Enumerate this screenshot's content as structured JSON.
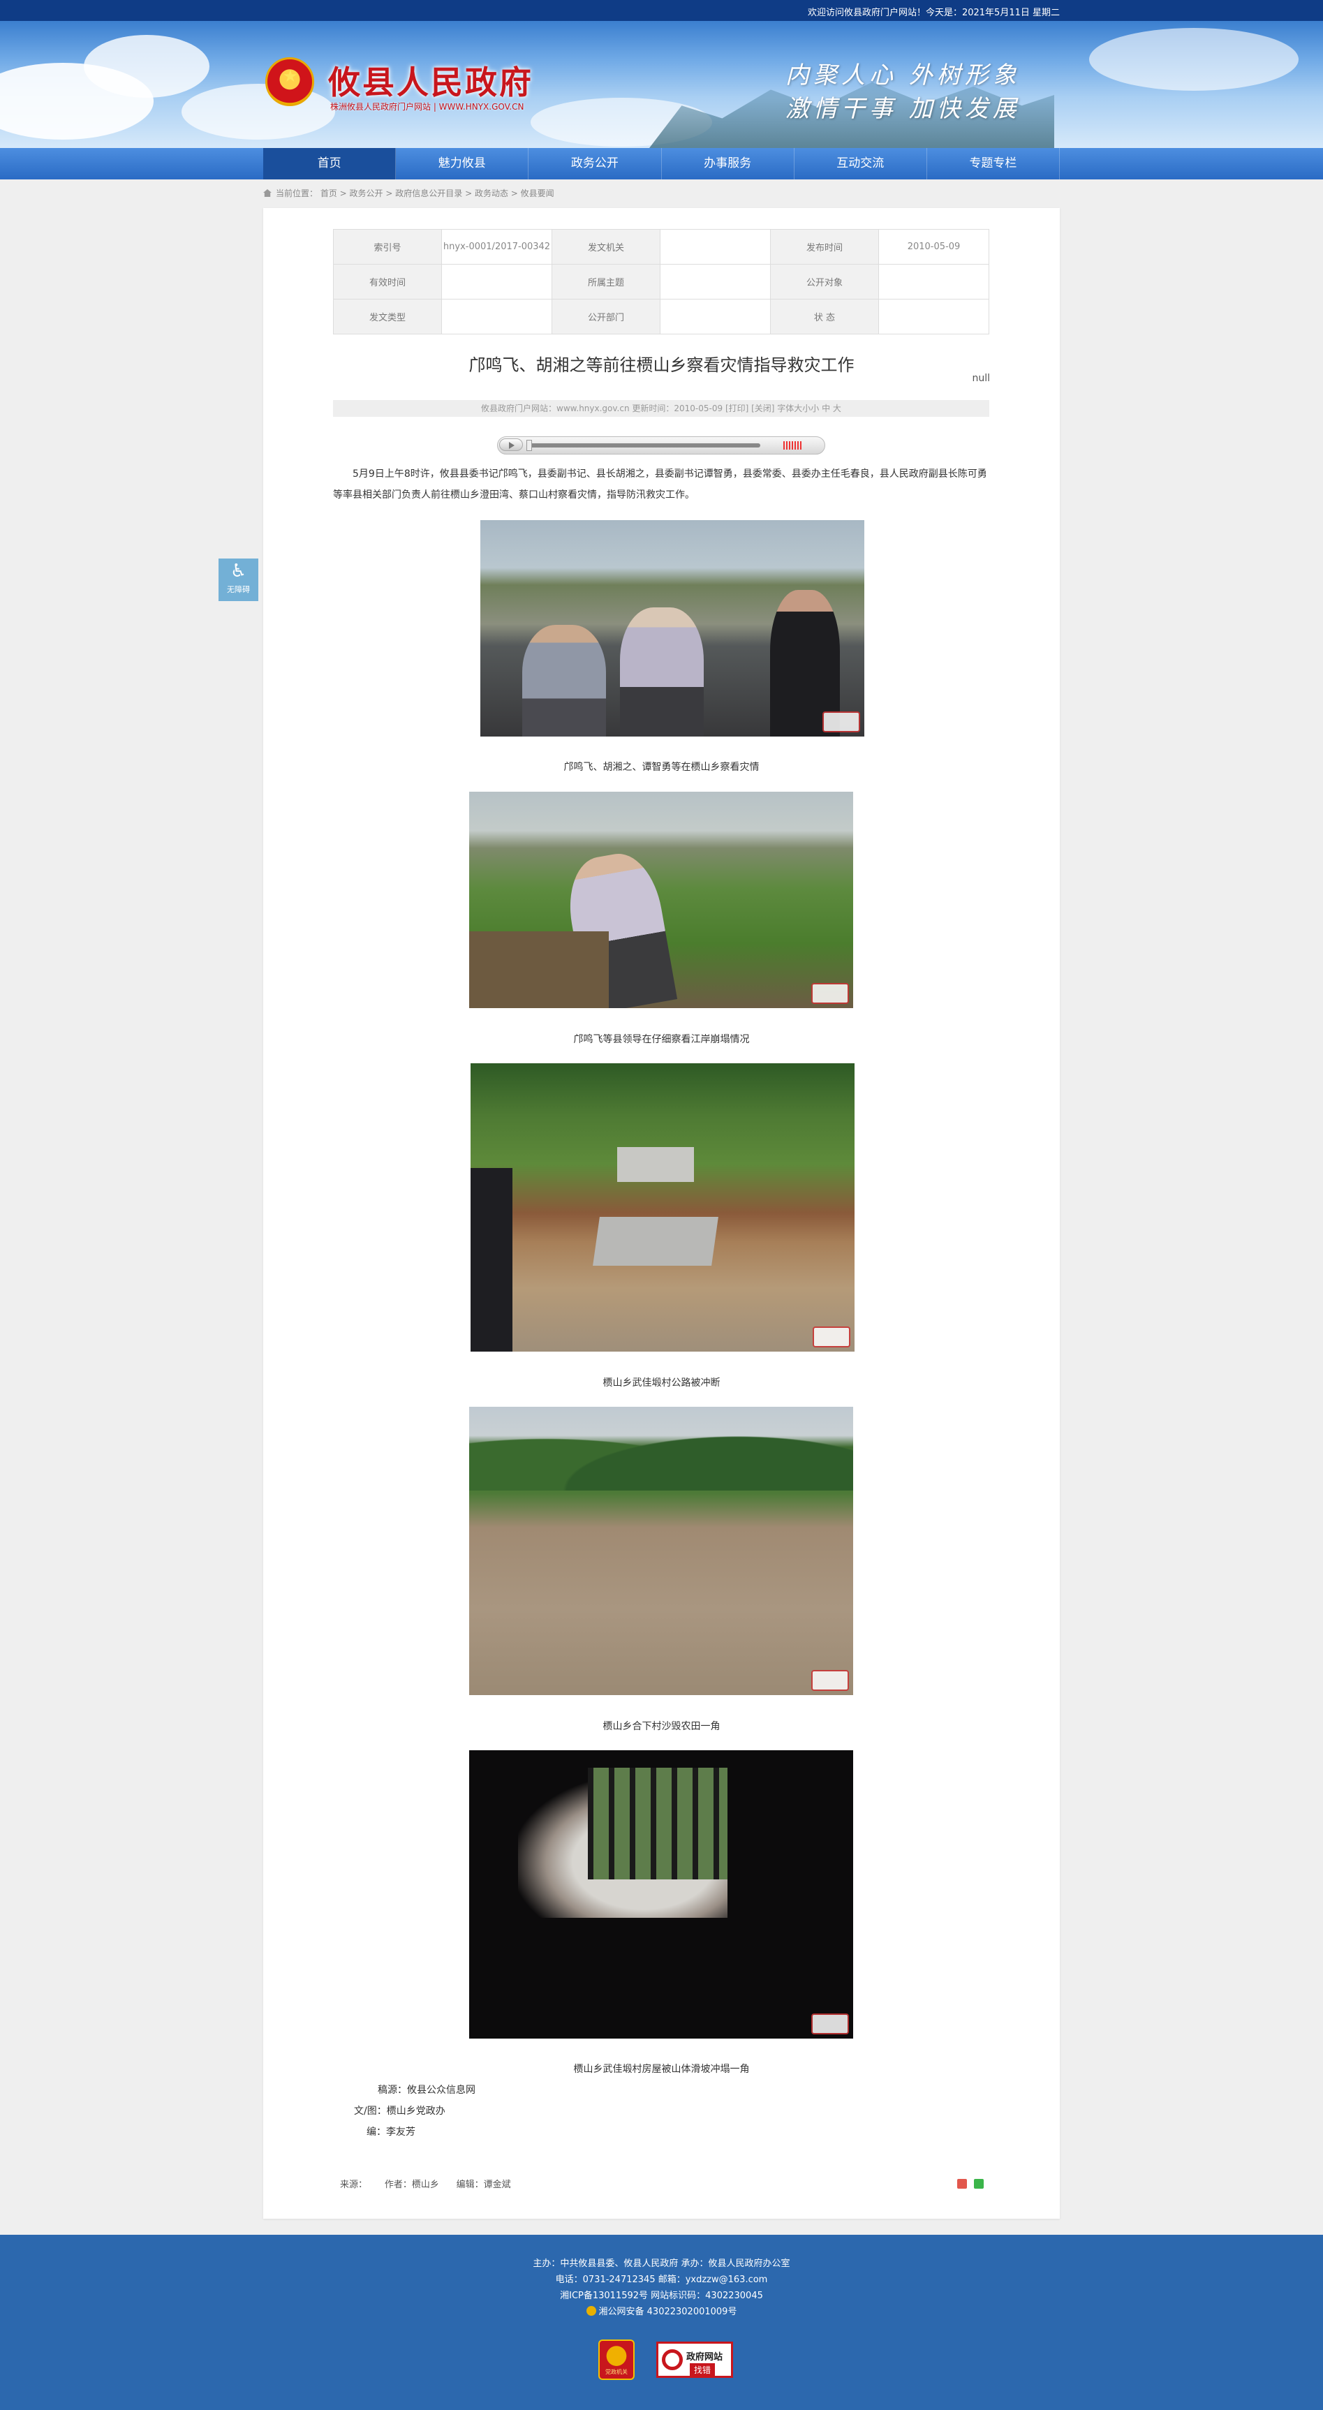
{
  "topbar": {
    "welcome": "欢迎访问攸县政府门户网站！今天是：2021年5月11日 星期二"
  },
  "header": {
    "site_title": "攸县人民政府",
    "site_subtitle": "株洲攸县人民政府门户网站 | WWW.HNYX.GOV.CN",
    "slogan_line1": "内聚人心 外树形象",
    "slogan_line2": "激情干事 加快发展"
  },
  "nav": {
    "items": [
      {
        "label": "首页"
      },
      {
        "label": "魅力攸县"
      },
      {
        "label": "政务公开"
      },
      {
        "label": "办事服务"
      },
      {
        "label": "互动交流"
      },
      {
        "label": "专题专栏"
      }
    ]
  },
  "breadcrumb": {
    "prefix": "当前位置：",
    "items": [
      "首页",
      "政务公开",
      "政府信息公开目录",
      "政务动态",
      "攸县要闻"
    ],
    "separator": " > "
  },
  "meta": {
    "index_no_label": "索引号",
    "index_no": "hnyx-0001/2017-00342",
    "issuing_org_label": "发文机关",
    "issuing_org": "",
    "publish_date_label": "发布时间",
    "publish_date": "2010-05-09",
    "valid_time_label": "有效时间",
    "valid_time": "",
    "category_label": "所属主题",
    "category": "",
    "audience_label": "公开对象",
    "audience": "",
    "doc_type_label": "发文类型",
    "doc_type": "",
    "dept_label": "公开部门",
    "dept": "",
    "status_label": "状 态",
    "status": ""
  },
  "article": {
    "title": "邝鸣飞、胡湘之等前往槚山乡察看灾情指导救灾工作",
    "null_text": "null",
    "info_bar": "攸县政府门户网站：www.hnyx.gov.cn   更新时间：2010-05-09   [打印] [关闭]   字体大小小 中 大",
    "paragraph": "5月9日上午8时许，攸县县委书记邝鸣飞，县委副书记、县长胡湘之，县委副书记谭智勇，县委常委、县委办主任毛春良，县人民政府副县长陈可勇等率县相关部门负责人前往槚山乡澄田湾、蔡口山村察看灾情，指导防汛救灾工作。",
    "captions": [
      "邝鸣飞、胡湘之、谭智勇等在槚山乡察看灾情",
      "邝鸣飞等县领导在仔细察看江岸崩塌情况",
      "槚山乡武佳塅村公路被冲断",
      "槚山乡合下村沙毁农田一角",
      "槚山乡武佳塅村房屋被山体滑坡冲塌一角"
    ],
    "credit_source": "稿源：攸县公众信息网",
    "credit_author": "文/图：槚山乡党政办",
    "credit_editor": "编：李友芳",
    "source_label": "来源：",
    "author_label": "作者：槚山乡",
    "editor_label": "编辑：谭金斌"
  },
  "accessibility": {
    "label": "无障碍",
    "icon": "wheelchair-icon"
  },
  "footer": {
    "line1": "主办：中共攸县县委、攸县人民政府 承办：攸县人民政府办公室",
    "line2": "电话：0731-24712345 邮箱：yxdzzw@163.com",
    "line3": "湘ICP备13011592号   网站标识码：4302230045",
    "line4": "湘公网安备 43022302001009号",
    "party_badge": "党政机关",
    "error_badge_title": "政府网站",
    "error_badge_sub": "找错"
  },
  "colors": {
    "nav_blue": "#2a6bc4",
    "footer_blue": "#2c68ae",
    "title_red": "#c8161d"
  }
}
